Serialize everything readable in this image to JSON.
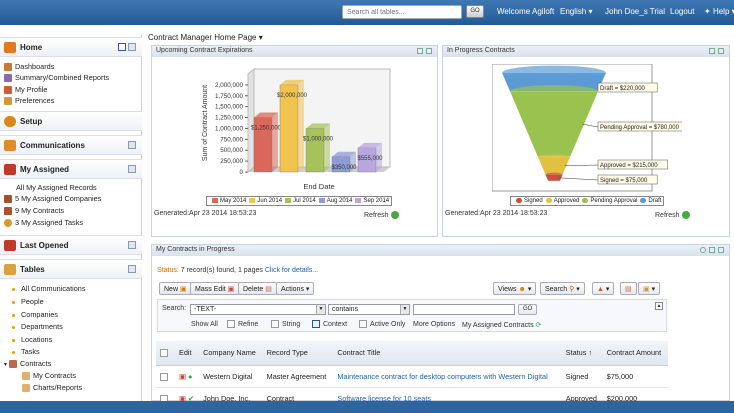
{
  "topbar": {
    "search_placeholder": "Search all tables...",
    "go_label": "GO",
    "welcome": "Welcome Agiloft",
    "language": "English ▾",
    "user": "John Doe_s Trial",
    "logout": "Logout",
    "help": "Help ▾"
  },
  "sidebar": {
    "home": "Home",
    "home_items": [
      "Dashboards",
      "Summary/Combined Reports",
      "My Profile",
      "Preferences"
    ],
    "setup": "Setup",
    "communications": "Communications",
    "my_assigned": "My Assigned",
    "assigned_items": [
      "All My Assigned Records",
      "5 My Assigned Companies",
      "9 My Contracts",
      "3 My Assigned Tasks"
    ],
    "last_opened": "Last Opened",
    "tables": "Tables",
    "table_items": [
      "All Communications",
      "People",
      "Companies",
      "Departments",
      "Locations",
      "Tasks"
    ],
    "contracts": "Contracts",
    "contract_items": [
      "My Contracts",
      "Charts/Reports"
    ]
  },
  "page_title": "Contract Manager Home Page ▾",
  "expirations": {
    "title": "Upcoming Contract Expirations",
    "generated": "Generated:Apr 23 2014 18:53:23",
    "refresh": "Refresh"
  },
  "inprogress": {
    "title": "In Progress Contracts",
    "generated": "Generated:Apr 23 2014 18:53:23",
    "refresh": "Refresh"
  },
  "mycontracts": {
    "title": "My Contracts in Progress",
    "status_label": "Status:",
    "status_text": "7 record(s) found, 1 pages",
    "details": "Click for details...",
    "toolbar": {
      "new": "New",
      "mass_edit": "Mass Edit",
      "delete": "Delete",
      "actions": "Actions ▾",
      "views": "Views",
      "search": "Search"
    },
    "search_label": "Search:",
    "field": "-TEXT-",
    "operator": "contains",
    "go": "GO",
    "options": {
      "show_all": "Show All",
      "refine": "Refine",
      "string": "String",
      "context": "Context",
      "active_only": "Active Only",
      "more": "More Options",
      "assigned": "My Assigned Contracts"
    },
    "columns": [
      "Edit",
      "Company Name",
      "Record Type",
      "Contract Title",
      "Status ↑",
      "Contract Amount"
    ],
    "rows": [
      {
        "company": "Western Digital",
        "type": "Master Agreement",
        "title": "Maintenance contract for desktop computers with Western Digital",
        "status": "Signed",
        "amount": "$75,000"
      },
      {
        "company": "John Doe, Inc.",
        "type": "Contract",
        "title": "Software license for 10 seats",
        "status": "Approved",
        "amount": "$200,000"
      }
    ]
  },
  "chart_data": [
    {
      "type": "bar",
      "title": "",
      "xlabel": "End Date",
      "ylabel": "Sum of Contract Amount",
      "ylim": [
        0,
        2250000
      ],
      "yticks": [
        "2,000,000",
        "1,750,000",
        "1,500,000",
        "1,250,000",
        "1,000,000",
        "750,000",
        "500,000",
        "250,000",
        "0"
      ],
      "series": [
        {
          "name": "May 2014",
          "value": 1250000,
          "label": "$1,250,000",
          "color": "#d9675a"
        },
        {
          "name": "Jun 2014",
          "value": 2000000,
          "label": "$2,000,000",
          "color": "#f2c24e"
        },
        {
          "name": "Jul 2014",
          "value": 1000000,
          "label": "$1,000,000",
          "color": "#a6c25a"
        },
        {
          "name": "Aug 2014",
          "value": 350000,
          "label": "$350,000",
          "color": "#8f9bd6"
        },
        {
          "name": "Sep 2014",
          "value": 555000,
          "label": "$555,000",
          "color": "#b9a6df"
        }
      ],
      "legend": "bottom"
    },
    {
      "type": "funnel",
      "stages": [
        {
          "name": "Draft",
          "value": 220000,
          "label": "Draft = $220,000",
          "color": "#5b9bd5"
        },
        {
          "name": "Pending Approval",
          "value": 780000,
          "label": "Pending Approval = $780,000",
          "color": "#9ac24e"
        },
        {
          "name": "Approved",
          "value": 215000,
          "label": "Approved = $215,000",
          "color": "#e3c042"
        },
        {
          "name": "Signed",
          "value": 75000,
          "label": "Signed = $75,000",
          "color": "#c94f3d"
        }
      ],
      "legend_order": [
        "Signed",
        "Approved",
        "Pending Approval",
        "Draft"
      ],
      "legend": "bottom"
    }
  ]
}
